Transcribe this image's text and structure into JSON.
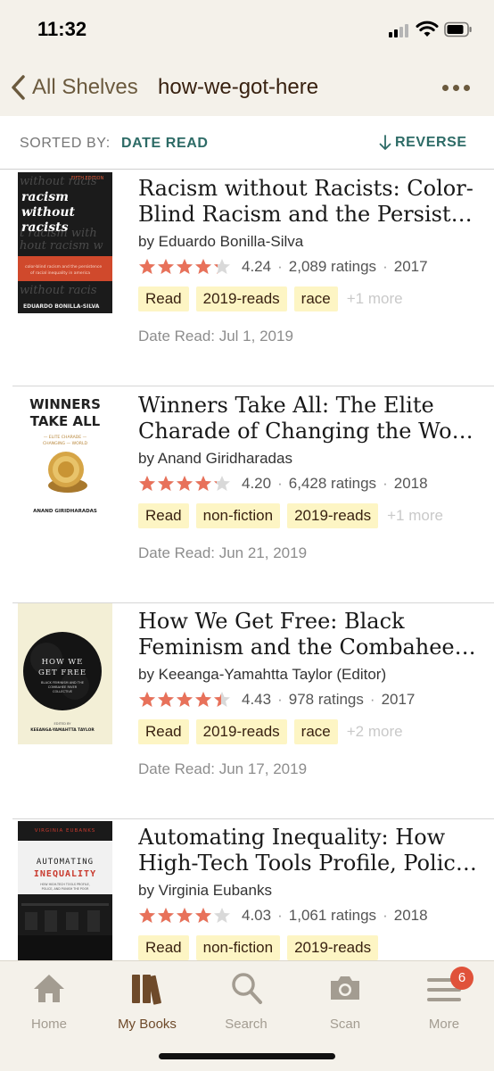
{
  "status_bar": {
    "time": "11:32"
  },
  "nav": {
    "back_label": "All Shelves",
    "title": "how-we-got-here"
  },
  "sort": {
    "sorted_by_label": "SORTED BY:",
    "sorted_by_value": "DATE READ",
    "reverse_label": "REVERSE"
  },
  "books": [
    {
      "title_line1": "Racism without Racists: Color-",
      "title_line2": "Blind Racism and the Persistence of Racial Inequality in America",
      "author": "by Eduardo Bonilla-Silva",
      "rating": "4.24",
      "rating_value": 4.24,
      "ratings_count": "2,089 ratings",
      "year": "2017",
      "tags": [
        "Read",
        "2019-reads",
        "race"
      ],
      "more_tags": "+1 more",
      "date_read": "Date Read: Jul 1, 2019",
      "cover": {
        "lines": [
          "racism",
          "without",
          "racists"
        ],
        "author": "EDUARDO BONILLA-SILVA",
        "edition": "FIFTH EDITION"
      }
    },
    {
      "title_line1": "Winners Take All: The Elite",
      "title_line2": "Charade of Changing the World",
      "author": "by Anand Giridharadas",
      "rating": "4.20",
      "rating_value": 4.2,
      "ratings_count": "6,428 ratings",
      "year": "2018",
      "tags": [
        "Read",
        "non-fiction",
        "2019-reads"
      ],
      "more_tags": "+1 more",
      "date_read": "Date Read: Jun 21, 2019",
      "cover": {
        "lines": [
          "WINNERS",
          "TAKE ALL"
        ],
        "subtitle": "THE ELITE CHARADE OF CHANGING THE WORLD",
        "author": "ANAND GIRIDHARADAS"
      }
    },
    {
      "title_line1": "How We Get Free: Black",
      "title_line2": "Feminism and the Combahee River Collective",
      "author": "by Keeanga-Yamahtta Taylor (Editor)",
      "rating": "4.43",
      "rating_value": 4.43,
      "ratings_count": "978 ratings",
      "year": "2017",
      "tags": [
        "Read",
        "2019-reads",
        "race"
      ],
      "more_tags": "+2 more",
      "date_read": "Date Read: Jun 17, 2019",
      "cover": {
        "lines": [
          "HOW WE",
          "GET FREE"
        ],
        "subtitle": "BLACK FEMINISM AND THE COMBAHEE RIVER COLLECTIVE",
        "editor_line": "EDITED BY",
        "author": "KEEANGA-YAMAHTTA TAYLOR"
      }
    },
    {
      "title_line1": "Automating Inequality: How",
      "title_line2": "High-Tech Tools Profile, Police, and Punish the Poor",
      "author": "by Virginia Eubanks",
      "rating": "4.03",
      "rating_value": 4.03,
      "ratings_count": "1,061 ratings",
      "year": "2018",
      "tags": [
        "Read",
        "non-fiction",
        "2019-reads"
      ],
      "more_tags": "",
      "date_read": "",
      "cover": {
        "author": "VIRGINIA EUBANKS",
        "lines": [
          "AUTOMATING",
          "INEQUALITY"
        ],
        "subtitle": "HOW HIGH-TECH TOOLS PROFILE, POLICE, AND PUNISH THE POOR"
      }
    }
  ],
  "tab_bar": {
    "tabs": [
      {
        "label": "Home",
        "icon": "home-icon"
      },
      {
        "label": "My Books",
        "icon": "books-icon",
        "active": true
      },
      {
        "label": "Search",
        "icon": "search-icon"
      },
      {
        "label": "Scan",
        "icon": "camera-icon"
      },
      {
        "label": "More",
        "icon": "menu-icon",
        "badge": "6"
      }
    ]
  },
  "colors": {
    "star_fill": "#e8715a",
    "star_empty": "#d9d9d9",
    "tag_bg": "#fdf5c4",
    "accent_teal": "#2d6b66",
    "nav_bg": "#f4f1ea",
    "badge": "#e0523a"
  }
}
